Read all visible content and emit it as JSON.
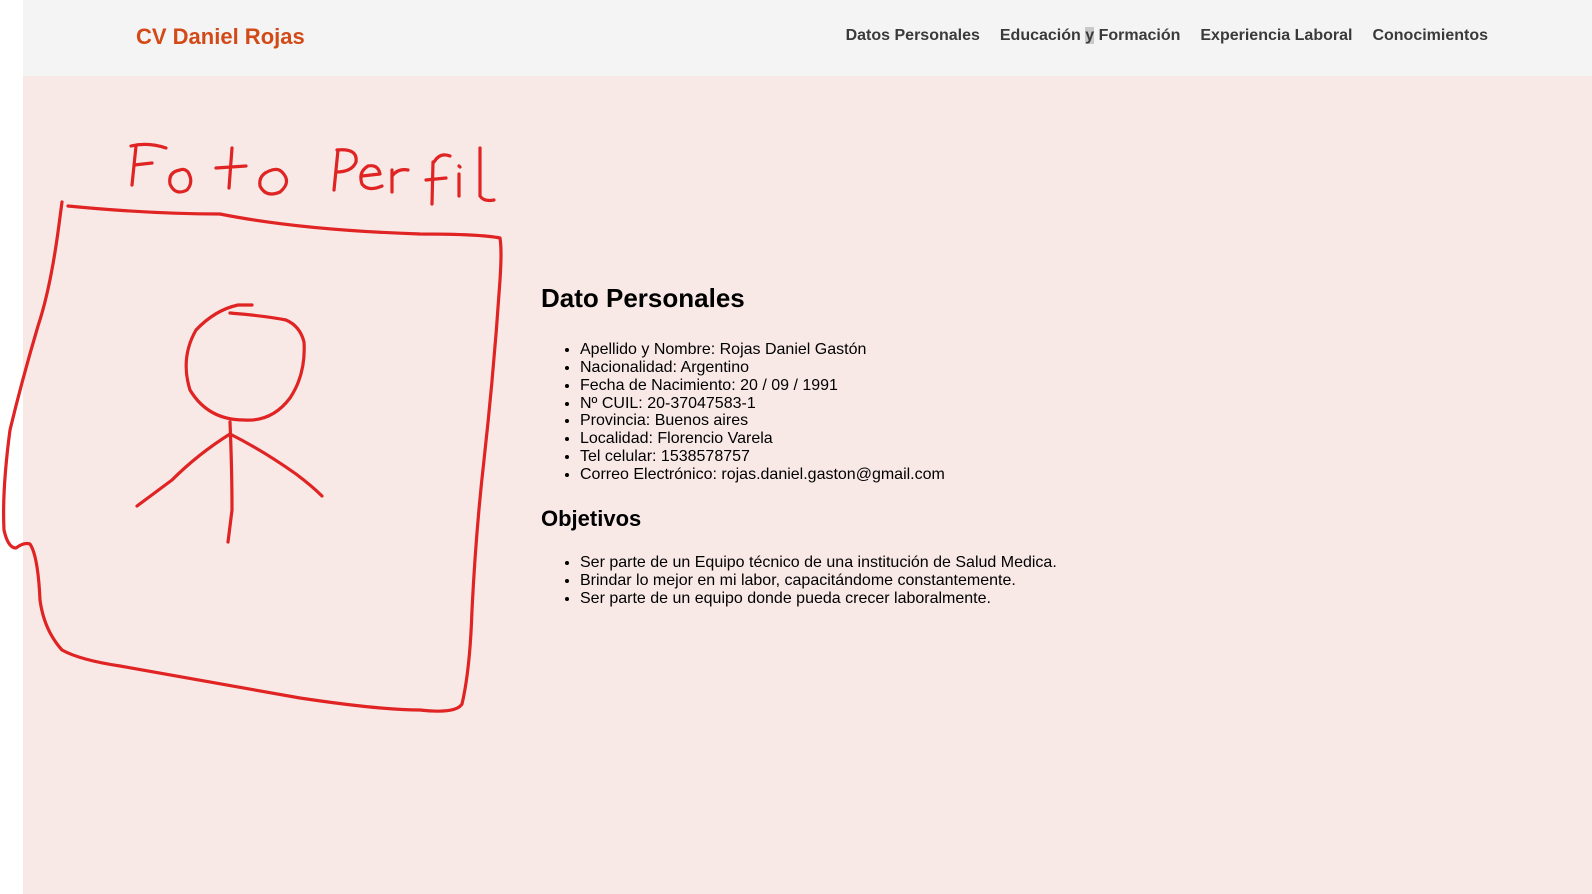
{
  "header": {
    "brand": "CV Daniel Rojas",
    "nav": [
      {
        "label_pre": "Datos Personales",
        "label_hl": "",
        "label_post": ""
      },
      {
        "label_pre": "Educación ",
        "label_hl": "y",
        "label_post": " Formación"
      },
      {
        "label_pre": "Experiencia Laboral",
        "label_hl": "",
        "label_post": ""
      },
      {
        "label_pre": "Conocimientos",
        "label_hl": "",
        "label_post": ""
      }
    ]
  },
  "profile_photo": {
    "caption": "Foto Perfil",
    "stroke_color": "#e02323"
  },
  "personal": {
    "title": "Dato Personales",
    "items": [
      "Apellido y Nombre: Rojas Daniel Gastón",
      "Nacionalidad: Argentino",
      "Fecha de Nacimiento: 20 / 09 / 1991",
      "Nº CUIL: 20-37047583-1",
      "Provincia: Buenos aires",
      "Localidad: Florencio Varela",
      "Tel celular: 1538578757",
      "Correo Electrónico: rojas.daniel.gaston@gmail.com"
    ]
  },
  "objectives": {
    "title": "Objetivos",
    "items": [
      "Ser parte de un Equipo técnico de una institución de Salud Medica.",
      "Brindar lo mejor en mi labor, capacitándome constantemente.",
      "Ser parte de un equipo donde pueda crecer laboralmente."
    ]
  },
  "colors": {
    "brand": "#d24a17",
    "page_bg": "#f8e9e7",
    "navbar_bg": "#f4f4f4",
    "nav_text": "#3a3a3a"
  }
}
